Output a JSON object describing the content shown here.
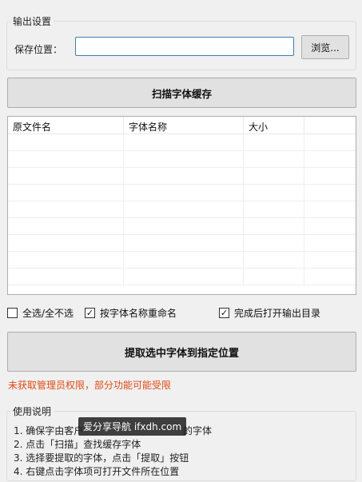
{
  "output_settings": {
    "title": "输出设置",
    "save_label": "保存位置：",
    "path_value": "",
    "browse_label": "浏览..."
  },
  "scan_button": "扫描字体缓存",
  "table": {
    "headers": [
      "原文件名",
      "字体名称",
      "大小",
      ""
    ],
    "rows": [
      [
        "",
        "",
        "",
        ""
      ],
      [
        "",
        "",
        "",
        ""
      ],
      [
        "",
        "",
        "",
        ""
      ],
      [
        "",
        "",
        "",
        ""
      ],
      [
        "",
        "",
        "",
        ""
      ],
      [
        "",
        "",
        "",
        ""
      ],
      [
        "",
        "",
        "",
        ""
      ],
      [
        "",
        "",
        "",
        ""
      ],
      [
        "",
        "",
        "",
        ""
      ]
    ]
  },
  "options": {
    "select_all": {
      "label": "全选/全不选",
      "checked": false
    },
    "rename_by_font": {
      "label": "按字体名称重命名",
      "checked": true
    },
    "open_output_dir": {
      "label": "完成后打开输出目录",
      "checked": true
    }
  },
  "extract_button": "提取选中字体到指定位置",
  "warning_text": "未获取管理员权限，部分功能可能受限",
  "instructions": {
    "title": "使用说明",
    "lines": [
      "1. 确保字由客户",
      "的字体",
      "2. 点击「扫描」查找缓存字体",
      "3. 选择要提取的字体，点击「提取」按钮",
      "4. 右键点击字体项可打开文件所在位置"
    ]
  },
  "watermark": "爱分享导航 ifxdh.com",
  "colors": {
    "warning": "#e04a16",
    "input_border": "#3c7fb1"
  }
}
